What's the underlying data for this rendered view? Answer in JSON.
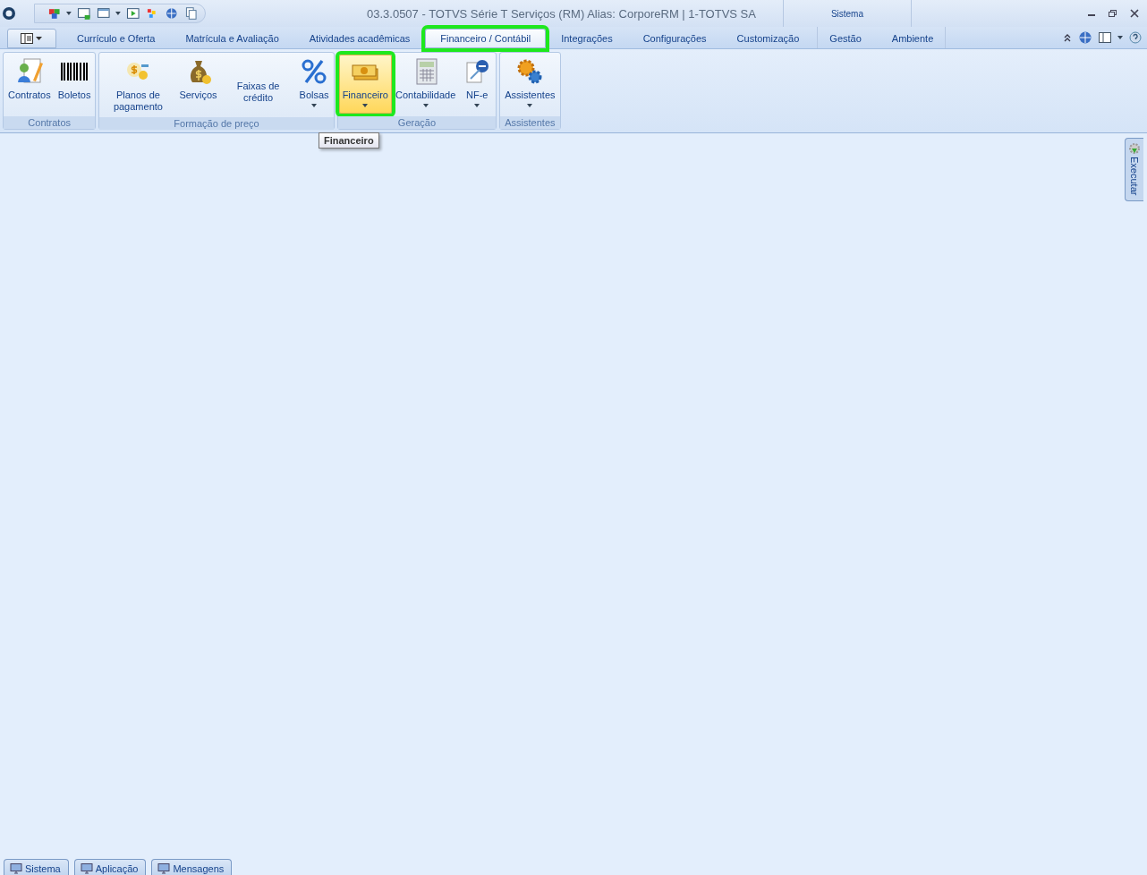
{
  "title_bar": {
    "title": "03.3.0507 - TOTVS Série T Serviços (RM) Alias: CorporeRM | 1-TOTVS SA",
    "context_label": "Sistema"
  },
  "tabs": [
    {
      "label": "Currículo e Oferta",
      "selected": false,
      "highlighted": false
    },
    {
      "label": "Matrícula e Avaliação",
      "selected": false,
      "highlighted": false
    },
    {
      "label": "Atividades acadêmicas",
      "selected": false,
      "highlighted": false
    },
    {
      "label": "Financeiro / Contábil",
      "selected": true,
      "highlighted": true
    },
    {
      "label": "Integrações",
      "selected": false,
      "highlighted": false
    },
    {
      "label": "Configurações",
      "selected": false,
      "highlighted": false
    },
    {
      "label": "Customização",
      "selected": false,
      "highlighted": false
    }
  ],
  "context_tabs": [
    {
      "label": "Gestão",
      "selected": false
    },
    {
      "label": "Ambiente",
      "selected": false
    }
  ],
  "ribbon_groups": [
    {
      "label": "Contratos",
      "buttons": [
        {
          "label": "Contratos",
          "kind": "contract",
          "dropdown": false,
          "hovered": false,
          "highlighted": false
        },
        {
          "label": "Boletos",
          "kind": "barcode",
          "dropdown": false,
          "hovered": false,
          "highlighted": false
        }
      ]
    },
    {
      "label": "Formação de preço",
      "buttons": [
        {
          "label": "Planos de pagamento",
          "kind": "coins",
          "dropdown": false,
          "hovered": false,
          "highlighted": false
        },
        {
          "label": "Serviços",
          "kind": "moneybag",
          "dropdown": false,
          "hovered": false,
          "highlighted": false
        },
        {
          "label": "Faixas de crédito",
          "kind": "text",
          "dropdown": false,
          "hovered": false,
          "highlighted": false
        },
        {
          "label": "Bolsas",
          "kind": "percent",
          "dropdown": true,
          "hovered": false,
          "highlighted": false
        }
      ]
    },
    {
      "label": "Geração",
      "buttons": [
        {
          "label": "Financeiro",
          "kind": "banknotes",
          "dropdown": true,
          "hovered": true,
          "highlighted": true
        },
        {
          "label": "Contabilidade",
          "kind": "calculator",
          "dropdown": true,
          "hovered": false,
          "highlighted": false
        },
        {
          "label": "NF-e",
          "kind": "document",
          "dropdown": true,
          "hovered": false,
          "highlighted": false
        }
      ]
    },
    {
      "label": "Assistentes",
      "buttons": [
        {
          "label": "Assistentes",
          "kind": "gears",
          "dropdown": true,
          "hovered": false,
          "highlighted": false
        }
      ]
    }
  ],
  "tooltip": "Financeiro",
  "side_tab": "Executar",
  "bottom_tabs": [
    "Sistema",
    "Aplicação",
    "Mensagens"
  ]
}
